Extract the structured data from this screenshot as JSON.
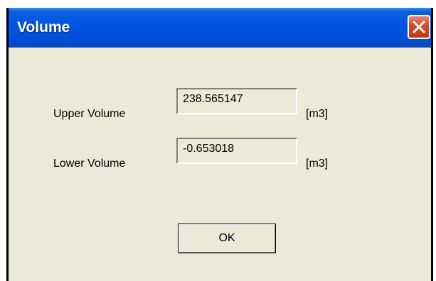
{
  "window": {
    "title": "Volume",
    "close_icon": "close-icon"
  },
  "colors": {
    "titlebar": "#0054E3",
    "dialog_bg": "#ECE9D8",
    "close_button": "#D64A22"
  },
  "fields": [
    {
      "label": "Upper Volume",
      "value": "238.565147",
      "unit": "[m3]"
    },
    {
      "label": "Lower Volume",
      "value": "-0.653018",
      "unit": "[m3]"
    }
  ],
  "buttons": {
    "ok_label": "OK"
  }
}
